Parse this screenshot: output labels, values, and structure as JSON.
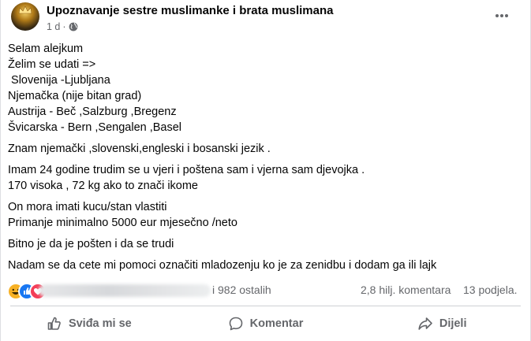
{
  "post": {
    "group_name": "Upoznavanje sestre muslimanke i brata muslimana",
    "time": "1 d",
    "separator": "·",
    "icons": {
      "avatar": "group-avatar",
      "privacy": "globe-icon",
      "menu": "more-options-icon"
    },
    "body": {
      "lines": [
        "Selam alejkum",
        "Želim se udati =>",
        " Slovenija -Ljubljana",
        "Njemačka (nije bitan grad)",
        "Austrija - Beč ,Salzburg ,Bregenz",
        "Švicarska - Bern ,Sengalen ,Basel",
        "",
        "Znam njemački ,slovenski,engleski i bosanski jezik .",
        "",
        "Imam 24 godine trudim se u vjeri i poštena sam i vjerna sam djevojka .",
        "170 visoka , 72 kg ako to znači ikome",
        "",
        "On mora imati kucu/stan vlastiti",
        "Primanje minimalno 5000 eur mjesečno /neto",
        "",
        "Bitno je da je pošten i da se trudi",
        "",
        "Nadam se da cete mi pomoci označiti mladozenju ko je za zenidbu i dodam ga ili lajk"
      ]
    }
  },
  "stats": {
    "reactions_suffix": "i 982 ostalih",
    "comments": "2,8 hilj. komentara",
    "shares": "13 podjela.",
    "reaction_icons": [
      "haha-reaction-icon",
      "like-reaction-icon",
      "love-reaction-icon"
    ]
  },
  "actions": {
    "like": "Sviđa mi se",
    "comment": "Komentar",
    "share": "Dijeli"
  },
  "colors": {
    "text": "#050505",
    "secondary": "#65676b",
    "like_blue": "#1877f2",
    "haha_yellow": "#f7b125",
    "love_red": "#f33e58"
  }
}
